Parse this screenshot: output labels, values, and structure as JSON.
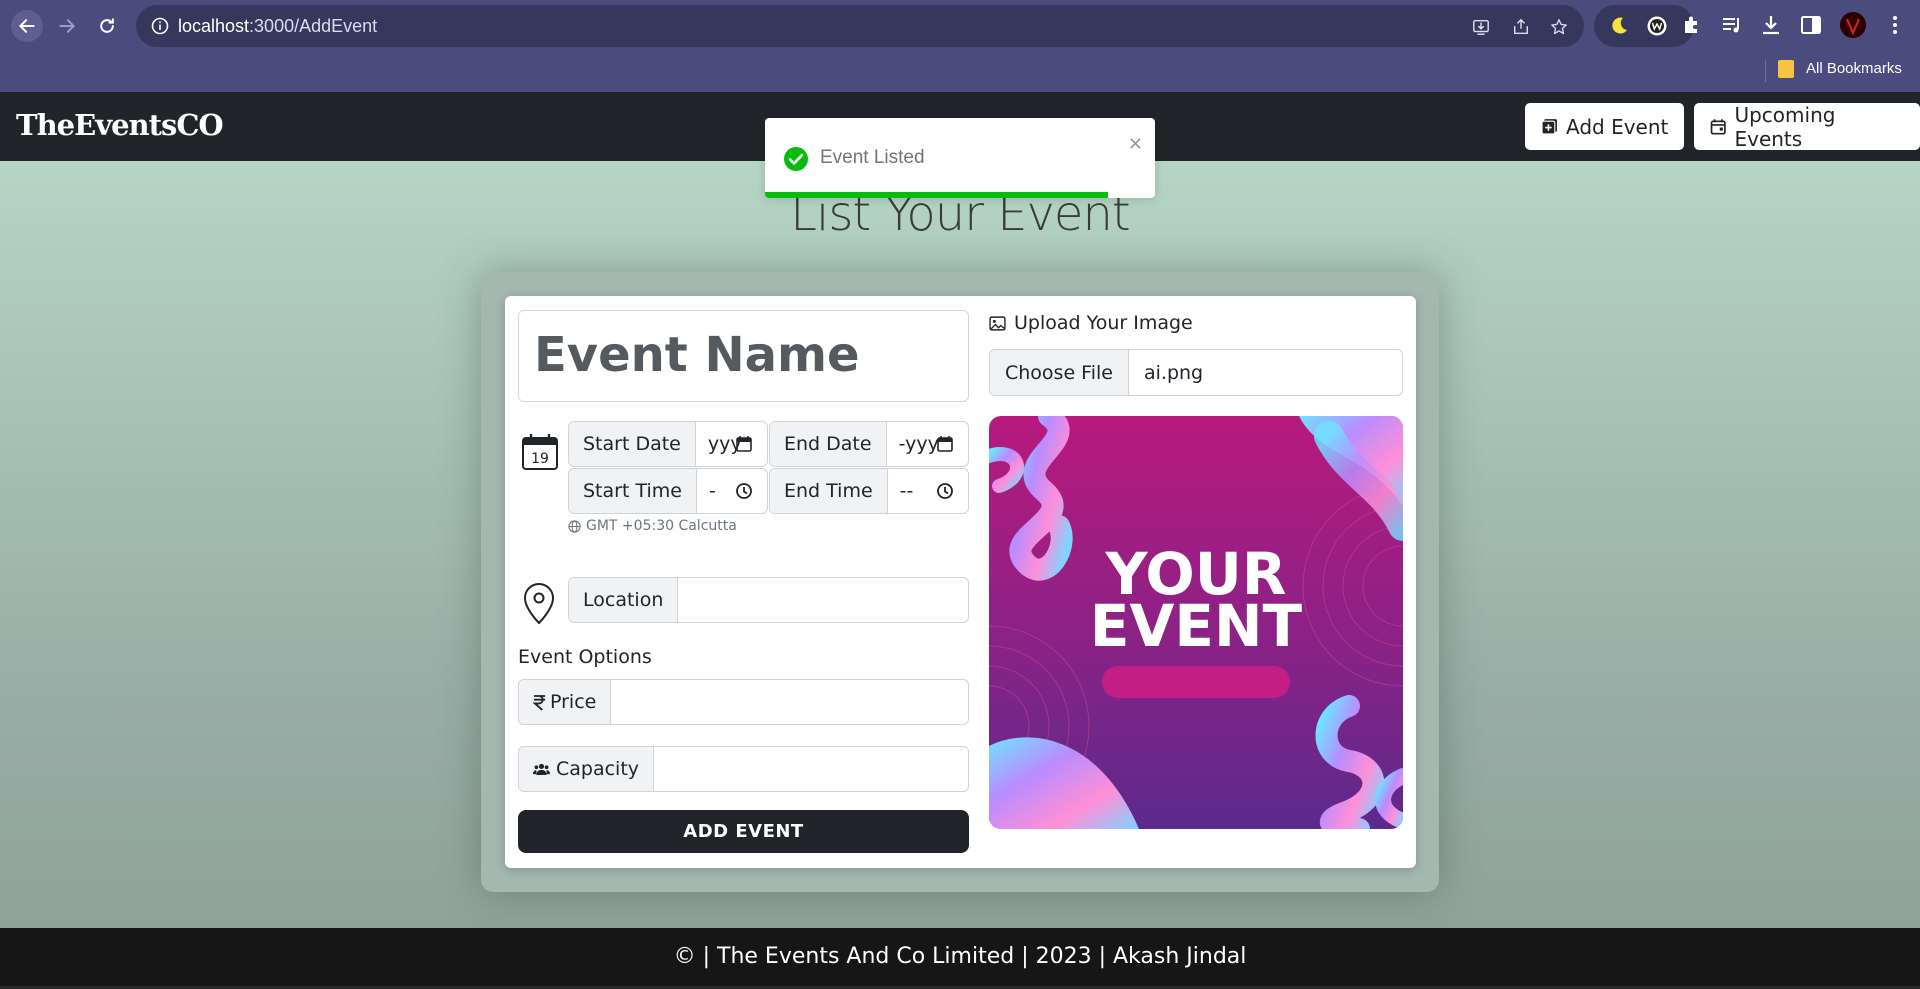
{
  "browser": {
    "url_host": "localhost",
    "url_path": ":3000/AddEvent",
    "bookmarks_label": "All Bookmarks",
    "colors": {
      "frame": "#4a4c7d",
      "omnibox": "#35375c"
    }
  },
  "header": {
    "brand": "TheEventsCO",
    "add_event_label": "Add Event",
    "upcoming_events_label": "Upcoming Events"
  },
  "toast": {
    "message": "Event Listed",
    "progress": 0.88,
    "color": "#07bc0c"
  },
  "main": {
    "title": "List Your Event",
    "form": {
      "event_name_placeholder": "Event Name",
      "calendar_day": "19",
      "start_date_label": "Start Date",
      "start_date_value": "yyy",
      "end_date_label": "End Date",
      "end_date_value": "-yyy",
      "start_time_label": "Start Time",
      "start_time_value": "-",
      "end_time_label": "End Time",
      "end_time_value": "--",
      "timezone": "GMT +05:30 Calcutta",
      "location_label": "Location",
      "location_value": "",
      "options_label": "Event Options",
      "price_label": "Price",
      "price_value": "",
      "capacity_label": "Capacity",
      "capacity_value": "",
      "submit_label": "ADD EVENT"
    },
    "upload": {
      "label": "Upload Your Image",
      "choose_file_label": "Choose File",
      "file_name": "ai.png",
      "preview_line1": "YOUR",
      "preview_line2": "EVENT"
    }
  },
  "footer": {
    "text": "© | The Events And Co Limited | 2023 | Akash Jindal"
  }
}
